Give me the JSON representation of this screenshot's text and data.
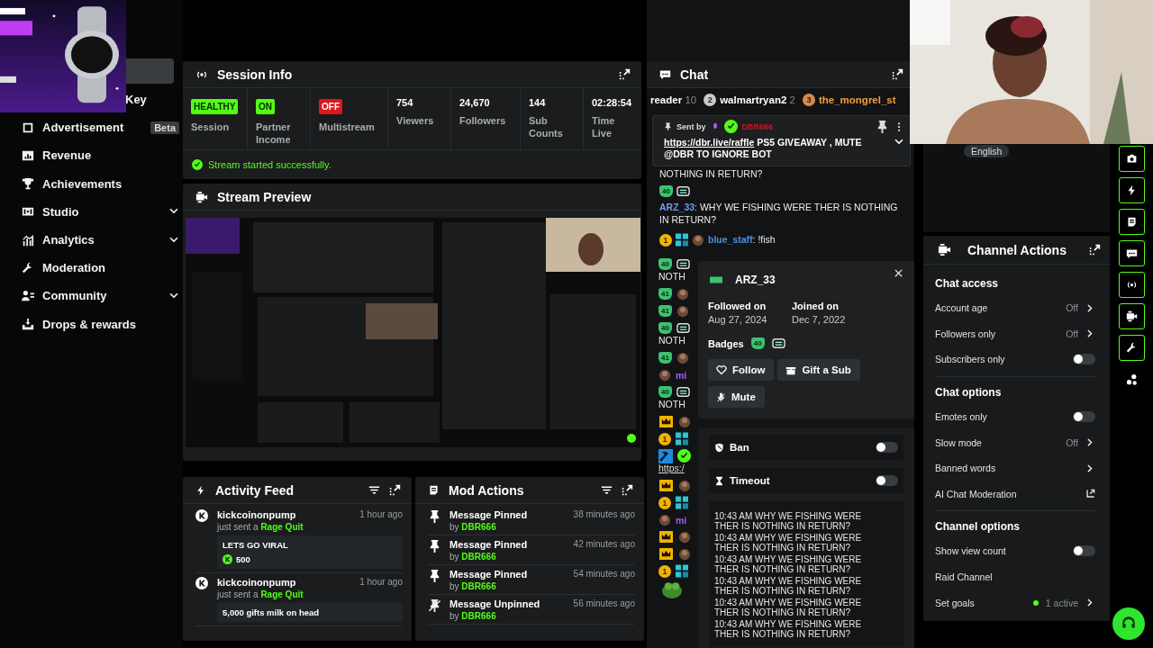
{
  "sidebar": {
    "items": [
      {
        "label": "Key",
        "expandable": false
      },
      {
        "label": "Advertisement",
        "badge": "Beta",
        "expandable": false
      },
      {
        "label": "Revenue",
        "expandable": false
      },
      {
        "label": "Achievements",
        "expandable": false
      },
      {
        "label": "Studio",
        "expandable": true
      },
      {
        "label": "Analytics",
        "expandable": true
      },
      {
        "label": "Moderation",
        "expandable": false
      },
      {
        "label": "Community",
        "expandable": true
      },
      {
        "label": "Drops & rewards",
        "expandable": false
      }
    ]
  },
  "session_info": {
    "title": "Session Info",
    "stats": [
      {
        "kind": "status",
        "value": "HEALTHY",
        "color": "#53fc18",
        "label": "Session"
      },
      {
        "kind": "status",
        "value": "ON",
        "color": "#53fc18",
        "label": "Partner Income"
      },
      {
        "kind": "status",
        "value": "OFF",
        "color": "#e0161c",
        "label": "Multistream"
      },
      {
        "kind": "number",
        "value": "754",
        "label": "Viewers"
      },
      {
        "kind": "number",
        "value": "24,670",
        "label": "Followers"
      },
      {
        "kind": "number",
        "value": "144",
        "label": "Sub Counts"
      },
      {
        "kind": "number",
        "value": "02:28:54",
        "label": "Time Live"
      }
    ],
    "status_message": "Stream started successfully."
  },
  "stream_preview": {
    "title": "Stream Preview"
  },
  "activity_feed": {
    "title": "Activity Feed",
    "items": [
      {
        "user": "kickcoinonpump",
        "action": "just sent a",
        "gift": "Rage Quit",
        "time": "1 hour ago",
        "message": "LETS GO VIRAL",
        "amount": "500"
      },
      {
        "user": "kickcoinonpump",
        "action": "just sent a",
        "gift": "Rage Quit",
        "time": "1 hour ago",
        "message": "5,000 gifts milk on head"
      }
    ]
  },
  "mod_actions": {
    "title": "Mod Actions",
    "items": [
      {
        "kind": "pin",
        "title": "Message Pinned",
        "by": "by",
        "moderator": "DBR666",
        "time": "38 minutes ago"
      },
      {
        "kind": "pin",
        "title": "Message Pinned",
        "by": "by",
        "moderator": "DBR666",
        "time": "42 minutes ago"
      },
      {
        "kind": "pin",
        "title": "Message Pinned",
        "by": "by",
        "moderator": "DBR666",
        "time": "54 minutes ago"
      },
      {
        "kind": "unpin",
        "title": "Message Unpinned",
        "by": "by",
        "moderator": "DBR666",
        "time": "56 minutes ago"
      }
    ]
  },
  "chat": {
    "title": "Chat",
    "leaderboard": [
      {
        "name": "reader",
        "count": "10",
        "color": "#ffffff"
      },
      {
        "rank": "2",
        "name": "walmartryan2",
        "count": "2",
        "color": "#ffffff"
      },
      {
        "rank": "3",
        "name": "the_mongrel_st",
        "color": "#f0a040"
      }
    ],
    "pinned": {
      "label": "Sent by",
      "sender": "DBR666",
      "link": "https://dbr.live/raffle",
      "text": " PS5 GIVEAWAY , MUTE @DBR TO IGNORE BOT"
    },
    "messages": [
      {
        "kind": "continuation",
        "text": "NOTHING IN RETURN?"
      },
      {
        "kind": "sub_message",
        "badge": "40",
        "user": "ARZ_33",
        "color": "#6f9cf0",
        "text": ": WHY WE FISHING WERE THER IS NOTHING IN RETURN?"
      },
      {
        "kind": "rank_message",
        "rank": "1",
        "user": "blue_staff",
        "color": "#4f8fe0",
        "text": ": !fish"
      }
    ],
    "fragments": [
      {
        "kind": "sub_sticker",
        "badge": "40",
        "text": "NOTH"
      },
      {
        "kind": "sub_avatar",
        "badge": "41"
      },
      {
        "kind": "sub_avatar",
        "badge": "41"
      },
      {
        "kind": "sub_sticker",
        "badge": "40",
        "text": "NOTH"
      },
      {
        "kind": "sub_avatar",
        "badge": "41"
      },
      {
        "kind": "user",
        "user": "mi"
      },
      {
        "kind": "sub_sticker",
        "badge": "40",
        "text": "NOTH"
      },
      {
        "kind": "crown"
      },
      {
        "kind": "rank_tile",
        "rank": "1"
      },
      {
        "kind": "mod",
        "link": "https:/"
      },
      {
        "kind": "crown"
      },
      {
        "kind": "rank_tile",
        "rank": "1"
      },
      {
        "kind": "user",
        "user": "mi"
      },
      {
        "kind": "crown"
      },
      {
        "kind": "crown"
      },
      {
        "kind": "rank_tile",
        "rank": "1"
      },
      {
        "kind": "emote"
      }
    ]
  },
  "user_card": {
    "username": "ARZ_33",
    "followed_label": "Followed on",
    "followed": "Aug 27, 2024",
    "joined_label": "Joined on",
    "joined": "Dec 7, 2022",
    "badges_label": "Badges",
    "badge": "40",
    "buttons": [
      {
        "kind": "follow",
        "label": "Follow"
      },
      {
        "kind": "gift",
        "label": "Gift a Sub"
      },
      {
        "kind": "mute",
        "label": "Mute"
      }
    ],
    "moderation": [
      {
        "kind": "ban",
        "label": "Ban",
        "on": false
      },
      {
        "kind": "timeout",
        "label": "Timeout",
        "on": false
      }
    ],
    "log": [
      "10:43 AM WHY WE FISHING WERE THER IS NOTHING IN RETURN?",
      "10:43 AM WHY WE FISHING WERE THER IS NOTHING IN RETURN?",
      "10:43 AM WHY WE FISHING WERE THER IS NOTHING IN RETURN?",
      "10:43 AM WHY WE FISHING WERE THER IS NOTHING IN RETURN?",
      "10:43 AM WHY WE FISHING WERE THER IS NOTHING IN RETURN?",
      "10:43 AM WHY WE FISHING WERE THER IS NOTHING IN RETURN?"
    ]
  },
  "stream_info": {
    "language": "English"
  },
  "channel_actions": {
    "title": "Channel Actions",
    "items": [
      {
        "kind": "heading",
        "label": "Chat access"
      },
      {
        "kind": "value",
        "label": "Account age",
        "value": "Off"
      },
      {
        "kind": "value",
        "label": "Followers only",
        "value": "Off"
      },
      {
        "kind": "toggle",
        "label": "Subscribers only",
        "on": false
      },
      {
        "kind": "heading",
        "label": "Chat options"
      },
      {
        "kind": "toggle",
        "label": "Emotes only",
        "on": false
      },
      {
        "kind": "value",
        "label": "Slow mode",
        "value": "Off"
      },
      {
        "kind": "link",
        "label": "Banned words"
      },
      {
        "kind": "external",
        "label": "AI Chat Moderation"
      },
      {
        "kind": "heading",
        "label": "Channel options"
      },
      {
        "kind": "toggle",
        "label": "Show view count",
        "on": false
      },
      {
        "kind": "plain",
        "label": "Raid Channel"
      },
      {
        "kind": "goal",
        "label": "Set goals",
        "value": "1 active"
      }
    ]
  },
  "rail": [
    {
      "kind": "camera"
    },
    {
      "kind": "bolt"
    },
    {
      "kind": "note"
    },
    {
      "kind": "chat"
    },
    {
      "kind": "broadcast"
    },
    {
      "kind": "video"
    },
    {
      "kind": "wrench"
    },
    {
      "kind": "dots"
    }
  ]
}
